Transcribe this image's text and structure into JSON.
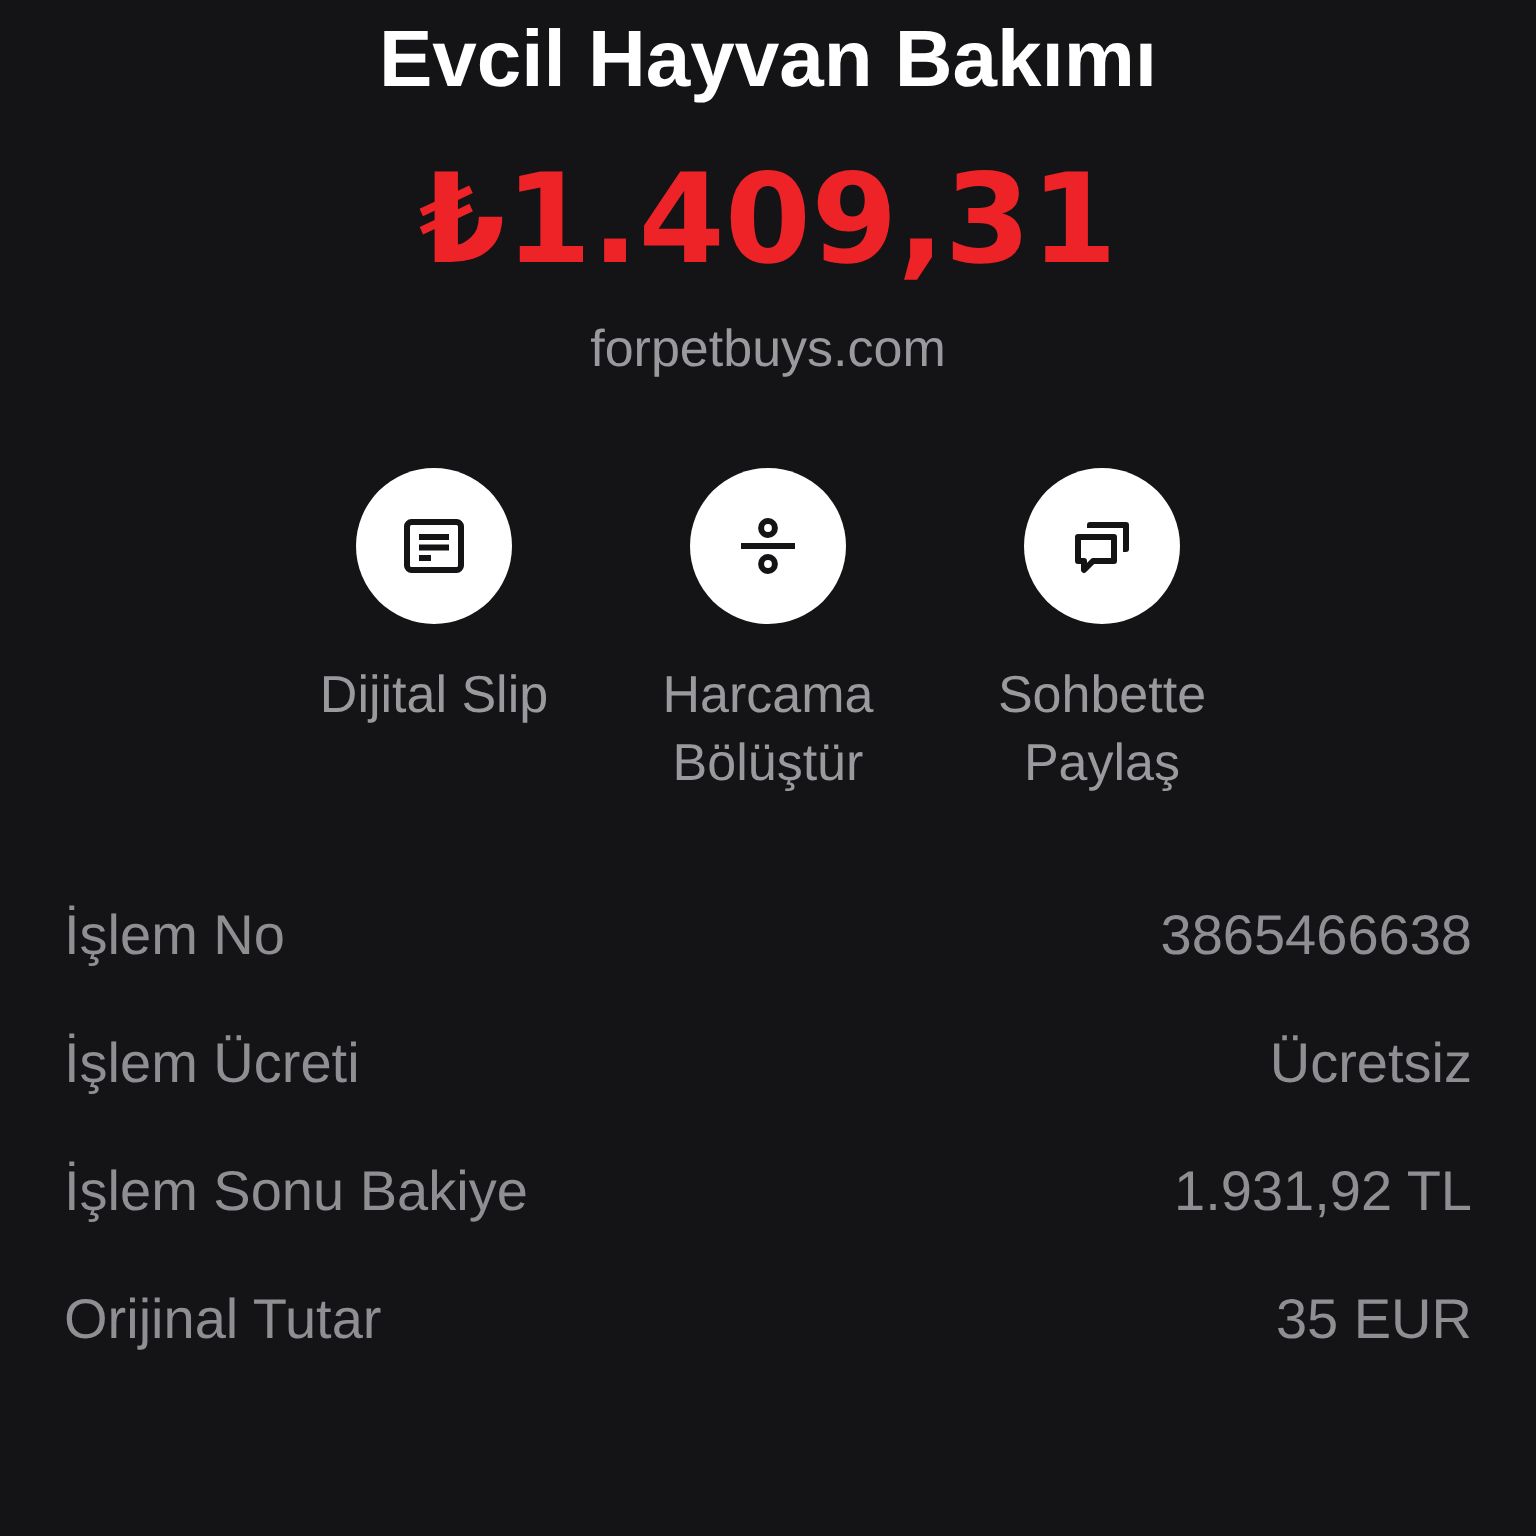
{
  "title": "Evcil Hayvan Bakımı",
  "amount": "₺1.409,31",
  "merchant": "forpetbuys.com",
  "actions": [
    {
      "kind": "receipt",
      "label_lines": [
        "Dijital Slip"
      ]
    },
    {
      "kind": "split",
      "label_lines": [
        "Harcama",
        "Bölüştür"
      ]
    },
    {
      "kind": "chat",
      "label_lines": [
        "Sohbette",
        "Paylaş"
      ]
    }
  ],
  "details": [
    {
      "label": "İşlem No",
      "value": "3865466638"
    },
    {
      "label": "İşlem Ücreti",
      "value": "Ücretsiz"
    },
    {
      "label": "İşlem Sonu Bakiye",
      "value": "1.931,92 TL"
    },
    {
      "label": "Orijinal Tutar",
      "value": "35 EUR"
    }
  ]
}
